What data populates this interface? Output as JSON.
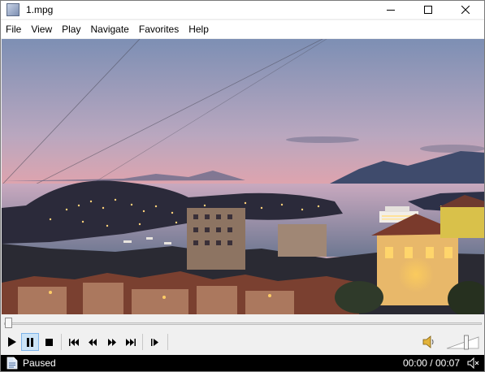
{
  "window": {
    "title": "1.mpg"
  },
  "menu": {
    "items": [
      "File",
      "View",
      "Play",
      "Navigate",
      "Favorites",
      "Help"
    ]
  },
  "video": {
    "description_icon": "sunset-city-harbor"
  },
  "seek": {
    "position_fraction": 0.0
  },
  "controls": {
    "buttons": [
      "play-icon",
      "pause-icon",
      "stop-icon",
      "skip-back-icon",
      "rewind-icon",
      "fast-forward-icon",
      "skip-forward-icon",
      "frame-step-icon"
    ],
    "pressed": "pause-icon"
  },
  "volume": {
    "level_fraction": 0.6
  },
  "status": {
    "text": "Paused",
    "time": "00:00 / 00:07"
  },
  "colors": {
    "statusbar": "#000000",
    "pressed_button": "#cce4f7",
    "window_bg": "#f0f0f0"
  }
}
